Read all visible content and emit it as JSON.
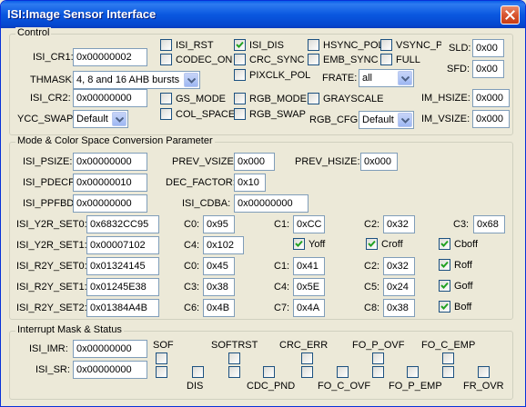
{
  "window": {
    "title": "ISI:Image Sensor Interface",
    "close_label": "close"
  },
  "control": {
    "title": "Control",
    "isi_cr1": {
      "label": "ISI_CR1:",
      "value": "0x00000002"
    },
    "thmask": {
      "label": "THMASK:",
      "value": "4, 8 and 16 AHB bursts"
    },
    "isi_cr2": {
      "label": "ISI_CR2:",
      "value": "0x00000000"
    },
    "ycc_swap": {
      "label": "YCC_SWAP:",
      "value": "Default"
    },
    "frate": {
      "label": "FRATE:",
      "value": "all"
    },
    "rgb_cfg": {
      "label": "RGB_CFG:",
      "value": "Default"
    },
    "sld": {
      "label": "SLD:",
      "value": "0x00"
    },
    "sfd": {
      "label": "SFD:",
      "value": "0x00"
    },
    "im_hsize": {
      "label": "IM_HSIZE:",
      "value": "0x000"
    },
    "im_vsize": {
      "label": "IM_VSIZE:",
      "value": "0x000"
    },
    "checks": [
      {
        "label": "ISI_RST",
        "checked": false
      },
      {
        "label": "CODEC_ON",
        "checked": false
      },
      {
        "label": "ISI_DIS",
        "checked": true
      },
      {
        "label": "CRC_SYNC",
        "checked": false
      },
      {
        "label": "PIXCLK_POL",
        "checked": false
      },
      {
        "label": "HSYNC_POL",
        "checked": false
      },
      {
        "label": "EMB_SYNC",
        "checked": false
      },
      {
        "label": "VSYNC_PO",
        "checked": false
      },
      {
        "label": "FULL",
        "checked": false
      },
      {
        "label": "GS_MODE",
        "checked": false
      },
      {
        "label": "COL_SPACE",
        "checked": false
      },
      {
        "label": "RGB_MODE",
        "checked": false
      },
      {
        "label": "RGB_SWAP",
        "checked": false
      },
      {
        "label": "GRAYSCALE",
        "checked": false
      }
    ]
  },
  "mode": {
    "title": "Mode & Color Space Conversion Parameter",
    "isi_psize": {
      "label": "ISI_PSIZE:",
      "value": "0x00000000"
    },
    "prev_vsize": {
      "label": "PREV_VSIZE:",
      "value": "0x000"
    },
    "prev_hsize": {
      "label": "PREV_HSIZE:",
      "value": "0x000"
    },
    "isi_pdecf": {
      "label": "ISI_PDECF:",
      "value": "0x00000010"
    },
    "dec_factor": {
      "label": "DEC_FACTOR:",
      "value": "0x10"
    },
    "isi_ppfbd": {
      "label": "ISI_PPFBD:",
      "value": "0x00000000"
    },
    "isi_cdba": {
      "label": "ISI_CDBA:",
      "value": "0x00000000"
    },
    "y2r_set0": {
      "label": "ISI_Y2R_SET0:",
      "value": "0x6832CC95"
    },
    "y2r_set1": {
      "label": "ISI_Y2R_SET1:",
      "value": "0x00007102"
    },
    "r2y_set0": {
      "label": "ISI_R2Y_SET0:",
      "value": "0x01324145"
    },
    "r2y_set1": {
      "label": "ISI_R2Y_SET1:",
      "value": "0x01245E38"
    },
    "r2y_set2": {
      "label": "ISI_R2Y_SET2:",
      "value": "0x01384A4B"
    },
    "y2r_c0": {
      "label": "C0:",
      "value": "0x95"
    },
    "y2r_c1": {
      "label": "C1:",
      "value": "0xCC"
    },
    "y2r_c2": {
      "label": "C2:",
      "value": "0x32"
    },
    "y2r_c3": {
      "label": "C3:",
      "value": "0x68"
    },
    "y2r_c4": {
      "label": "C4:",
      "value": "0x102"
    },
    "r2y_c0": {
      "label": "C0:",
      "value": "0x45"
    },
    "r2y_c1": {
      "label": "C1:",
      "value": "0x41"
    },
    "r2y_c2": {
      "label": "C2:",
      "value": "0x32"
    },
    "r2y_c3": {
      "label": "C3:",
      "value": "0x38"
    },
    "r2y_c4": {
      "label": "C4:",
      "value": "0x5E"
    },
    "r2y_c5": {
      "label": "C5:",
      "value": "0x24"
    },
    "r2y_c6": {
      "label": "C6:",
      "value": "0x4B"
    },
    "r2y_c7": {
      "label": "C7:",
      "value": "0x4A"
    },
    "r2y_c8": {
      "label": "C8:",
      "value": "0x38"
    },
    "yoff": {
      "label": "Yoff",
      "checked": true
    },
    "croff": {
      "label": "Croff",
      "checked": true
    },
    "cboff": {
      "label": "Cboff",
      "checked": true
    },
    "roff": {
      "label": "Roff",
      "checked": true
    },
    "goff": {
      "label": "Goff",
      "checked": true
    },
    "boff": {
      "label": "Boff",
      "checked": true
    }
  },
  "irq": {
    "title": "Interrupt Mask & Status",
    "isi_imr": {
      "label": "ISI_IMR:",
      "value": "0x00000000"
    },
    "isi_sr": {
      "label": "ISI_SR:",
      "value": "0x00000000"
    },
    "top_labels": [
      "SOF",
      "SOFTRST",
      "CRC_ERR",
      "FO_P_OVF",
      "FO_C_EMP"
    ],
    "bottom_labels": [
      "DIS",
      "CDC_PND",
      "FO_C_OVF",
      "FO_P_EMP",
      "FR_OVR"
    ]
  }
}
